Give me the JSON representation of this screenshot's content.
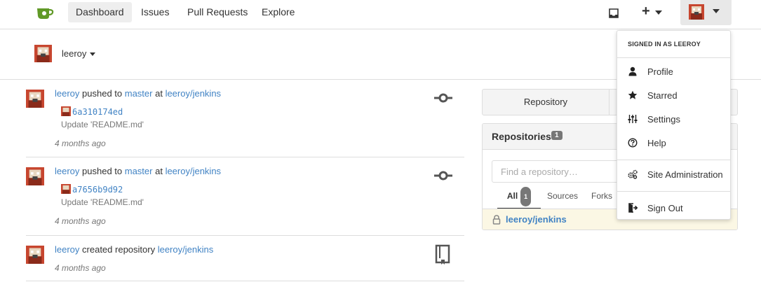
{
  "nav": {
    "items": [
      {
        "label": "Dashboard",
        "active": true
      },
      {
        "label": "Issues"
      },
      {
        "label": "Pull Requests"
      },
      {
        "label": "Explore"
      }
    ],
    "plus_label": "+"
  },
  "context": {
    "user": "leeroy"
  },
  "feed": [
    {
      "user": "leeroy",
      "verb": " pushed to ",
      "branch": "master",
      "prep": " at ",
      "repo": "leeroy/jenkins",
      "commit_sha": "6a310174ed",
      "commit_msg": "Update 'README.md'",
      "time": "4 months ago",
      "icon": "commit-icon"
    },
    {
      "user": "leeroy",
      "verb": " pushed to ",
      "branch": "master",
      "prep": " at ",
      "repo": "leeroy/jenkins",
      "commit_sha": "a7656b9d92",
      "commit_msg": "Update 'README.md'",
      "time": "4 months ago",
      "icon": "commit-icon"
    },
    {
      "user": "leeroy",
      "verb": " created repository ",
      "repo": "leeroy/jenkins",
      "time": "4 months ago",
      "icon": "book-icon"
    }
  ],
  "panel": {
    "tab_repository": "Repository",
    "repos_title": "Repositories",
    "repos_count": "1",
    "search_placeholder": "Find a repository…",
    "tabs": [
      {
        "label": "All",
        "count": "1",
        "active": true
      },
      {
        "label": "Sources"
      },
      {
        "label": "Forks"
      }
    ],
    "repo_item": "leeroy/jenkins"
  },
  "dropdown": {
    "header": "SIGNED IN AS LEEROY",
    "items": [
      {
        "label": "Profile",
        "icon": "person-icon"
      },
      {
        "label": "Starred",
        "icon": "star-icon"
      },
      {
        "label": "Settings",
        "icon": "settings-sliders-icon"
      },
      {
        "label": "Help",
        "icon": "help-icon"
      },
      {
        "label": "Site Administration",
        "icon": "server-gears-icon"
      },
      {
        "label": "Sign Out",
        "icon": "sign-out-icon"
      }
    ]
  },
  "colors": {
    "link": "#4183c4",
    "logo": "#609926",
    "highlight_row": "#fbf7e4"
  }
}
